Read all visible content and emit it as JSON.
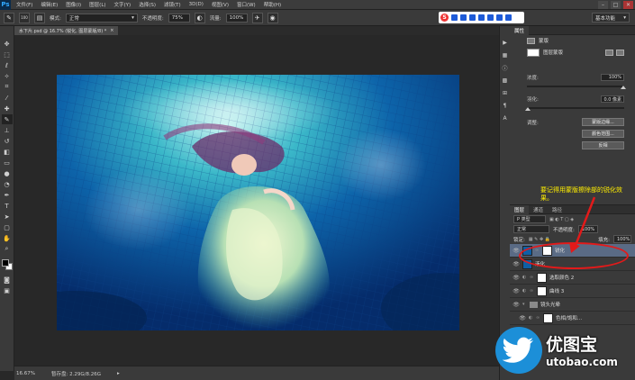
{
  "menubar": {
    "logo": "Ps",
    "items": [
      "文件(F)",
      "编辑(E)",
      "图像(I)",
      "图层(L)",
      "文字(Y)",
      "选择(S)",
      "滤镜(T)",
      "3D(D)",
      "视图(V)",
      "窗口(W)",
      "帮助(H)"
    ],
    "min": "–",
    "max": "□",
    "close": "✕"
  },
  "options": {
    "brush_size": "100",
    "mode_label": "模式:",
    "mode_value": "正常",
    "opacity_label": "不透明度:",
    "opacity_value": "75%",
    "flow_label": "流量:",
    "flow_value": "100%",
    "workspace": "基本功能"
  },
  "document": {
    "tab_title": "水下片.psd @ 16.7% (锐化, 图层蒙版/8) *",
    "tab_close": "×",
    "zoom": "16.67%",
    "doc_size": "暂存盘: 2.29G/8.26G"
  },
  "properties": {
    "tabs": [
      "属性"
    ],
    "header": "蒙版",
    "mask_type": "图层蒙版",
    "density_label": "浓度:",
    "density_value": "100%",
    "feather_label": "羽化:",
    "feather_value": "0.0 像素",
    "refine_label": "调整:",
    "btn_edge": "蒙版边缘...",
    "btn_color_range": "颜色范围...",
    "btn_invert": "反相",
    "annotation": "要记得用蒙版擦除部的锐化效果。"
  },
  "layers": {
    "tabs": [
      "图层",
      "通道",
      "路径"
    ],
    "kind": "P 类型",
    "blend": "正常",
    "opacity_label": "不透明度:",
    "opacity": "100%",
    "lock_label": "锁定:",
    "fill_label": "填充:",
    "fill": "100%",
    "items": [
      {
        "name": "锐化",
        "selected": true,
        "kind": "image-mask"
      },
      {
        "name": "液化",
        "selected": false,
        "kind": "image"
      },
      {
        "name": "选取颜色 2",
        "selected": false,
        "kind": "adjust"
      },
      {
        "name": "曲线 3",
        "selected": false,
        "kind": "adjust"
      },
      {
        "name": "镜头光晕",
        "selected": false,
        "kind": "group"
      },
      {
        "name": "色相/饱和...",
        "selected": false,
        "kind": "adjust"
      }
    ]
  },
  "watermark": {
    "cn": "优图宝",
    "url": "utobao.com"
  },
  "colors": {
    "accent": "#31a8ff",
    "annotation": "#ffee00",
    "highlight": "#e21a1a"
  }
}
